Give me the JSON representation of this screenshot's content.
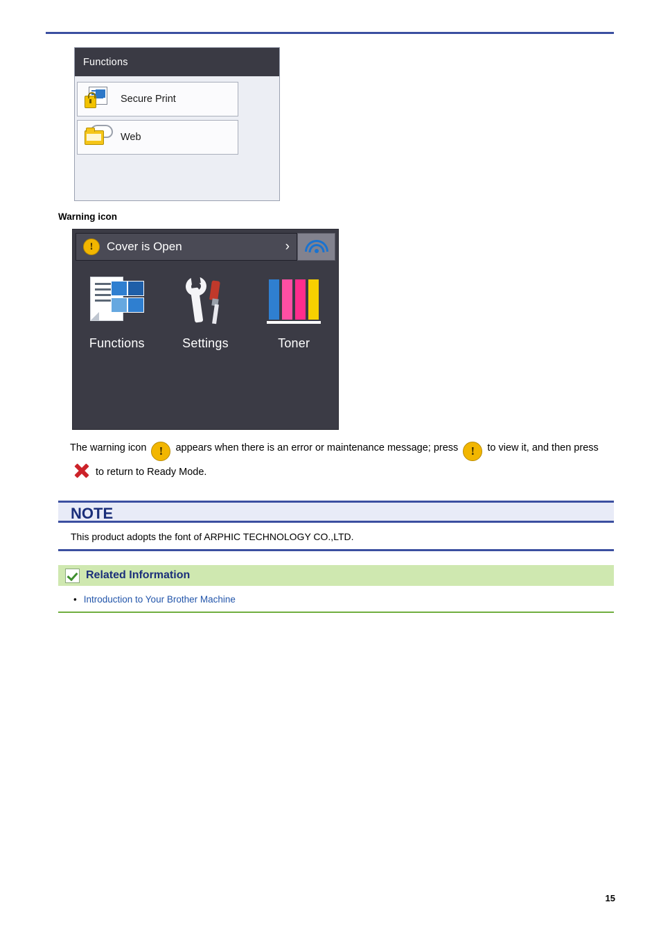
{
  "document": {
    "page_number": "15"
  },
  "functions_panel": {
    "title": "Functions",
    "items": [
      {
        "label": "Secure Print",
        "icon": "secure-print-icon"
      },
      {
        "label": "Web",
        "icon": "web-cloud-folder-icon"
      }
    ]
  },
  "warning_section": {
    "caption": "Warning icon"
  },
  "home_screen": {
    "status_message": "Cover is Open",
    "status_icon": "warning-icon",
    "chevron": "›",
    "wifi_icon": "wifi-icon",
    "apps": [
      {
        "label": "Functions",
        "icon": "functions-icon"
      },
      {
        "label": "Settings",
        "icon": "settings-tools-icon"
      },
      {
        "label": "Toner",
        "icon": "toner-bars-icon"
      }
    ]
  },
  "paragraph": {
    "part1": "The warning icon",
    "part2": "appears when there is an error or maintenance message; press",
    "part3": "to view it, and then press",
    "part4": "to return to Ready Mode.",
    "warning_glyph": "!",
    "close_icon": "red-x-icon"
  },
  "note": {
    "heading": "NOTE",
    "body": "This product adopts the font of ARPHIC TECHNOLOGY CO.,LTD."
  },
  "related_information": {
    "heading": "Related Information",
    "check_icon": "green-check-icon",
    "links": [
      {
        "bullet": "•",
        "label": "Introduction to Your Brother Machine"
      }
    ]
  },
  "colors": {
    "rule_blue": "#3b4fa0",
    "note_bg": "#e8ebf7",
    "related_bg": "#cfe8b0",
    "link_blue": "#2255aa",
    "warning_yellow": "#f2b600",
    "close_red": "#cc2229"
  }
}
